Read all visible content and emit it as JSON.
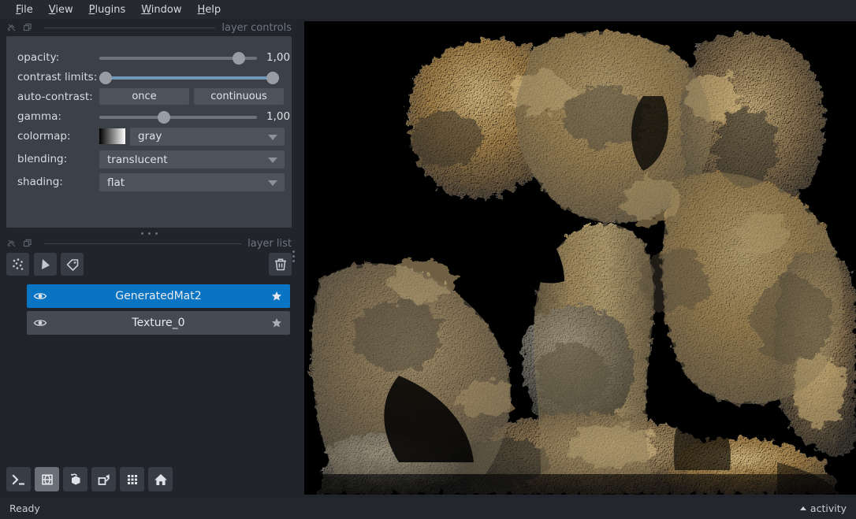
{
  "menubar": {
    "items": [
      {
        "mnemonic": "F",
        "rest": "ile"
      },
      {
        "mnemonic": "V",
        "rest": "iew"
      },
      {
        "mnemonic": "P",
        "rest": "lugins"
      },
      {
        "mnemonic": "W",
        "rest": "indow"
      },
      {
        "mnemonic": "H",
        "rest": "elp"
      }
    ]
  },
  "layer_controls": {
    "panel_title": "layer controls",
    "rows": {
      "opacity": {
        "label": "opacity:",
        "value": "1,00",
        "knob_pct": 92
      },
      "contrast_limits": {
        "label": "contrast limits:",
        "low_pct": 0,
        "high_pct": 100
      },
      "auto_contrast": {
        "label": "auto-contrast:",
        "once": "once",
        "continuous": "continuous"
      },
      "gamma": {
        "label": "gamma:",
        "value": "1,00",
        "knob_pct": 40
      },
      "colormap": {
        "label": "colormap:",
        "value": "gray"
      },
      "blending": {
        "label": "blending:",
        "value": "translucent"
      },
      "shading": {
        "label": "shading:",
        "value": "flat"
      }
    }
  },
  "layer_list": {
    "panel_title": "layer list",
    "toolbar": [
      {
        "name": "new-points-layer",
        "icon": "points-icon"
      },
      {
        "name": "new-shapes-layer",
        "icon": "shapes-icon"
      },
      {
        "name": "new-labels-layer",
        "icon": "labels-icon"
      }
    ],
    "delete_label": "delete-icon",
    "layers": [
      {
        "name": "GeneratedMat2",
        "visible": true,
        "selected": true,
        "linked": true
      },
      {
        "name": "Texture_0",
        "visible": true,
        "selected": false,
        "linked": true
      }
    ]
  },
  "bottom_toolbar": [
    {
      "name": "console-button",
      "icon": "console-icon",
      "active": false
    },
    {
      "name": "ndisplay-button",
      "icon": "cube-wireframe-icon",
      "active": true
    },
    {
      "name": "roll-dims-button",
      "icon": "cube-roll-icon",
      "active": false
    },
    {
      "name": "transpose-button",
      "icon": "transpose-icon",
      "active": false
    },
    {
      "name": "grid-view-button",
      "icon": "grid-icon",
      "active": false
    },
    {
      "name": "home-button",
      "icon": "home-icon",
      "active": false
    }
  ],
  "statusbar": {
    "status": "Ready",
    "activity": "activity"
  },
  "canvas": {
    "background": "#000000",
    "subject": "3D rendered coral mesh"
  },
  "colors": {
    "window_bg": "#21242b",
    "panel_bg": "#3b4049",
    "control_bg": "#4d535d",
    "accent": "#0a74c4",
    "text": "#d8dbe0",
    "muted_text": "#6f7580"
  }
}
